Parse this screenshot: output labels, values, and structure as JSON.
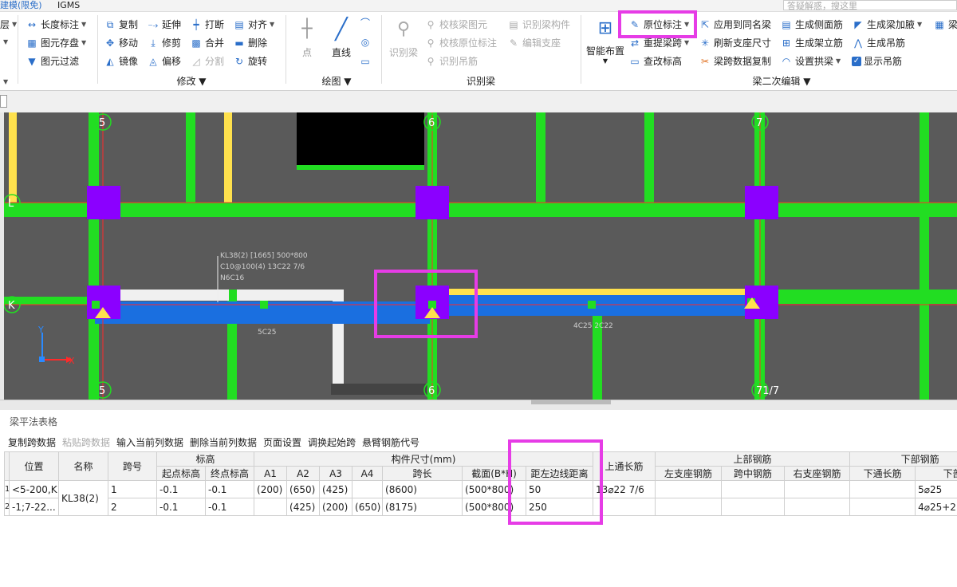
{
  "titlebar": {
    "left_text": "建模(限免)",
    "app_text": "IGMS",
    "search_placeholder": "答疑解惑，搜这里"
  },
  "ribbon": {
    "col0": [
      {
        "label": "层",
        "icon": "layer-icon"
      },
      {
        "label": "",
        "icon": "dropdown-icon"
      }
    ],
    "edit_group": [
      {
        "label": "长度标注",
        "icon": "dimension-icon"
      },
      {
        "label": "图元存盘",
        "icon": "save-element-icon"
      },
      {
        "label": "图元过滤",
        "icon": "filter-icon"
      }
    ],
    "modify": {
      "label": "修改",
      "items": [
        {
          "label": "复制",
          "icon": "copy-icon"
        },
        {
          "label": "延伸",
          "icon": "extend-icon"
        },
        {
          "label": "打断",
          "icon": "break-icon"
        },
        {
          "label": "对齐",
          "icon": "align-icon"
        },
        {
          "label": "移动",
          "icon": "move-icon"
        },
        {
          "label": "修剪",
          "icon": "trim-icon"
        },
        {
          "label": "合并",
          "icon": "merge-icon"
        },
        {
          "label": "删除",
          "icon": "delete-icon"
        },
        {
          "label": "镜像",
          "icon": "mirror-icon"
        },
        {
          "label": "偏移",
          "icon": "offset-icon"
        },
        {
          "label": "分割",
          "icon": "split-icon"
        },
        {
          "label": "旋转",
          "icon": "rotate-icon"
        }
      ]
    },
    "draw": {
      "label": "绘图",
      "point": "点",
      "line": "直线"
    },
    "identify": {
      "label": "识别梁",
      "identify_beam": "识别梁",
      "items": [
        {
          "label": "校核梁图元",
          "icon": "check-beam-icon"
        },
        {
          "label": "识别梁构件",
          "icon": "identify-component-icon"
        },
        {
          "label": "校核原位标注",
          "icon": "check-annotation-icon"
        },
        {
          "label": "编辑支座",
          "icon": "edit-support-icon"
        },
        {
          "label": "识别吊筋",
          "icon": "identify-hanger-icon"
        }
      ]
    },
    "secondary": {
      "label": "梁二次编辑",
      "smart_layout": "智能布置",
      "items": [
        {
          "label": "原位标注",
          "icon": "in-situ-annotation-icon"
        },
        {
          "label": "应用到同名梁",
          "icon": "apply-same-name-icon"
        },
        {
          "label": "生成侧面筋",
          "icon": "side-rebar-icon"
        },
        {
          "label": "生成梁加腋",
          "icon": "haunch-icon"
        },
        {
          "label": "梁",
          "icon": "beam-icon"
        },
        {
          "label": "重提梁跨",
          "icon": "reextract-span-icon"
        },
        {
          "label": "刷新支座尺寸",
          "icon": "refresh-support-icon"
        },
        {
          "label": "生成架立筋",
          "icon": "erection-rebar-icon"
        },
        {
          "label": "生成吊筋",
          "icon": "hanger-rebar-icon"
        },
        {
          "label": "查改标高",
          "icon": "elevation-icon"
        },
        {
          "label": "梁跨数据复制",
          "icon": "span-copy-icon"
        },
        {
          "label": "设置拱梁",
          "icon": "arch-beam-icon"
        },
        {
          "label": "显示吊筋",
          "icon": "checkbox-checked-icon"
        }
      ]
    }
  },
  "canvas": {
    "axes": {
      "top": [
        "5",
        "6",
        "7"
      ],
      "bottom": [
        "5",
        "6",
        "71/7"
      ],
      "left": [
        "L",
        "K"
      ]
    },
    "beam_label": [
      "KL38(2) [1665] 500*800",
      "C10@100(4) 13C22 7/6",
      "N6C16"
    ],
    "span1_bottom": "5C25",
    "span2_bottom": "4C25 2C22",
    "ucs": {
      "x": "X",
      "y": "Y"
    }
  },
  "panel": {
    "title": "梁平法表格",
    "toolbar": [
      "复制跨数据",
      "粘贴跨数据",
      "输入当前列数据",
      "删除当前列数据",
      "页面设置",
      "调换起始跨",
      "悬臂钢筋代号"
    ],
    "toolbar_disabled": [
      false,
      true,
      false,
      false,
      false,
      false,
      false
    ],
    "headers_top": {
      "position": "位置",
      "name": "名称",
      "span": "跨号",
      "elev": "标高",
      "dims": "构件尺寸(mm)",
      "top_through": "上通长筋",
      "top_rebar": "上部钢筋",
      "bottom_rebar": "下部钢筋"
    },
    "headers_sub": [
      "起点标高",
      "终点标高",
      "A1",
      "A2",
      "A3",
      "A4",
      "跨长",
      "截面(B*H)",
      "距左边线距离",
      "左支座钢筋",
      "跨中钢筋",
      "右支座钢筋",
      "下通长筋",
      "下部"
    ],
    "rows": [
      {
        "idx": "1",
        "position": "<5-200,K",
        "name": "KL38(2)",
        "span": "1",
        "start_elev": "-0.1",
        "end_elev": "-0.1",
        "a1": "(200)",
        "a2": "(650)",
        "a3": "(425)",
        "a4": "",
        "span_len": "(8600)",
        "section": "(500*800)",
        "left_dist": "50",
        "top_through": "13⌀22 7/6",
        "left_support": "",
        "mid": "",
        "right_support": "",
        "bottom_through": "",
        "bottom": "5⌀25"
      },
      {
        "idx": "2",
        "position": "-1;7-22...",
        "name": "",
        "span": "2",
        "start_elev": "-0.1",
        "end_elev": "-0.1",
        "a1": "",
        "a2": "(425)",
        "a3": "(200)",
        "a4": "(650)",
        "span_len": "(8175)",
        "section": "(500*800)",
        "left_dist": "250",
        "top_through": "",
        "left_support": "",
        "mid": "",
        "right_support": "",
        "bottom_through": "",
        "bottom": "4⌀25+2"
      }
    ]
  },
  "colors": {
    "highlight": "#e63ce6",
    "beam_green": "#22dd22",
    "column_purple": "#8b00ff",
    "beam_blue": "#1a6fe0",
    "canvas_bg": "#5a5a5a",
    "yellow": "#ffe14d"
  }
}
